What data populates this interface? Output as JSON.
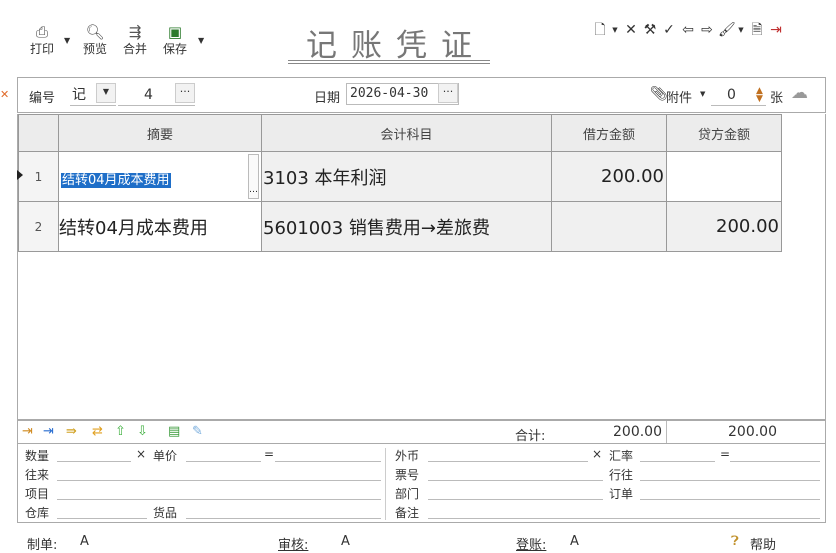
{
  "toolbar": {
    "print": "打印",
    "preview": "预览",
    "merge": "合并",
    "save": "保存"
  },
  "title": "记账凭证",
  "header": {
    "number_label": "编号",
    "voucher_word": "记",
    "voucher_number": "4",
    "date_label": "日期",
    "date_value": "2026-04-30",
    "attach_label": "附件",
    "attach_count": "0",
    "attach_unit": "张"
  },
  "columns": {
    "summary": "摘要",
    "account": "会计科目",
    "debit": "借方金额",
    "credit": "贷方金额"
  },
  "rows": [
    {
      "n": "1",
      "summary": "结转04月成本费用",
      "account": "3103 本年利润",
      "debit": "200.00",
      "credit": ""
    },
    {
      "n": "2",
      "summary": "结转04月成本费用",
      "account": "5601003 销售费用→差旅费",
      "debit": "",
      "credit": "200.00"
    }
  ],
  "totals": {
    "label": "合计:",
    "debit": "200.00",
    "credit": "200.00"
  },
  "aux": {
    "quantity": "数量",
    "times1": "×",
    "unit_price": "单价",
    "equals1": "=",
    "contact": "往来",
    "project": "项目",
    "warehouse": "仓库",
    "goods": "货品",
    "foreign_currency": "外币",
    "times2": "×",
    "exchange_rate": "汇率",
    "equals2": "=",
    "ticket_no": "票号",
    "bank": "行往",
    "department": "部门",
    "order": "订单",
    "remark": "备注"
  },
  "footer": {
    "maker_label": "制单:",
    "maker_value": "A",
    "audit_label": "审核:",
    "audit_value": "A",
    "post_label": "登账:",
    "post_value": "A",
    "help": "帮助"
  },
  "colors": {
    "selection": "#1e6ec8",
    "header_bg": "#ececec",
    "cell_bg": "#f0f0f0"
  }
}
